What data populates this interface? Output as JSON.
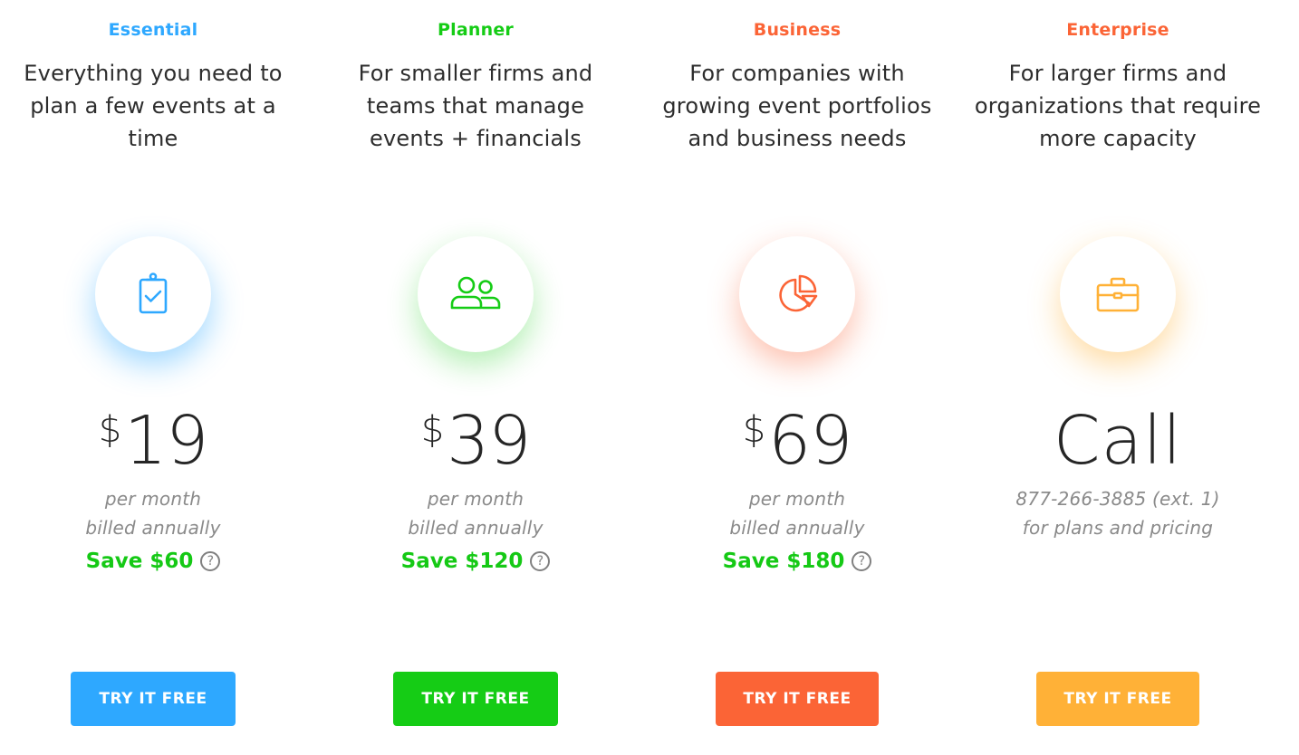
{
  "plans": [
    {
      "id": "essential",
      "name": "Essential",
      "color": "#2ea8ff",
      "description_lines": [
        "Everything you need to",
        "plan a few events at a",
        "time"
      ],
      "icon": "clipboard-check-icon",
      "price": {
        "currency": "$",
        "amount": "19"
      },
      "billing_lines": [
        "per month",
        "billed annually"
      ],
      "save": "Save $60",
      "help_glyph": "?",
      "cta": "TRY IT FREE"
    },
    {
      "id": "planner",
      "name": "Planner",
      "color": "#15cc15",
      "description_lines": [
        "For smaller firms and",
        "teams that manage",
        "events + financials"
      ],
      "icon": "users-icon",
      "price": {
        "currency": "$",
        "amount": "39"
      },
      "billing_lines": [
        "per month",
        "billed annually"
      ],
      "save": "Save $120",
      "help_glyph": "?",
      "cta": "TRY IT FREE"
    },
    {
      "id": "business",
      "name": "Business",
      "color": "#fb6436",
      "description_lines": [
        "For companies with",
        "growing event portfolios",
        "and business needs"
      ],
      "icon": "pie-chart-icon",
      "price": {
        "currency": "$",
        "amount": "69"
      },
      "billing_lines": [
        "per month",
        "billed annually"
      ],
      "save": "Save $180",
      "help_glyph": "?",
      "cta": "TRY IT FREE"
    },
    {
      "id": "enterprise",
      "name": "Enterprise",
      "color": "#ffb137",
      "description_lines": [
        "For larger firms and",
        "organizations that require",
        "more capacity"
      ],
      "icon": "briefcase-icon",
      "price": {
        "currency": "",
        "amount": "Call"
      },
      "billing_lines": [
        "877-266-3885 (ext. 1)",
        "for plans and pricing"
      ],
      "cta": "TRY IT FREE"
    }
  ],
  "name_colors": {
    "essential": "#2ea8ff",
    "planner": "#15cc15",
    "business": "#fb6436",
    "enterprise": "#fb6436"
  },
  "save_color": "#15c915"
}
